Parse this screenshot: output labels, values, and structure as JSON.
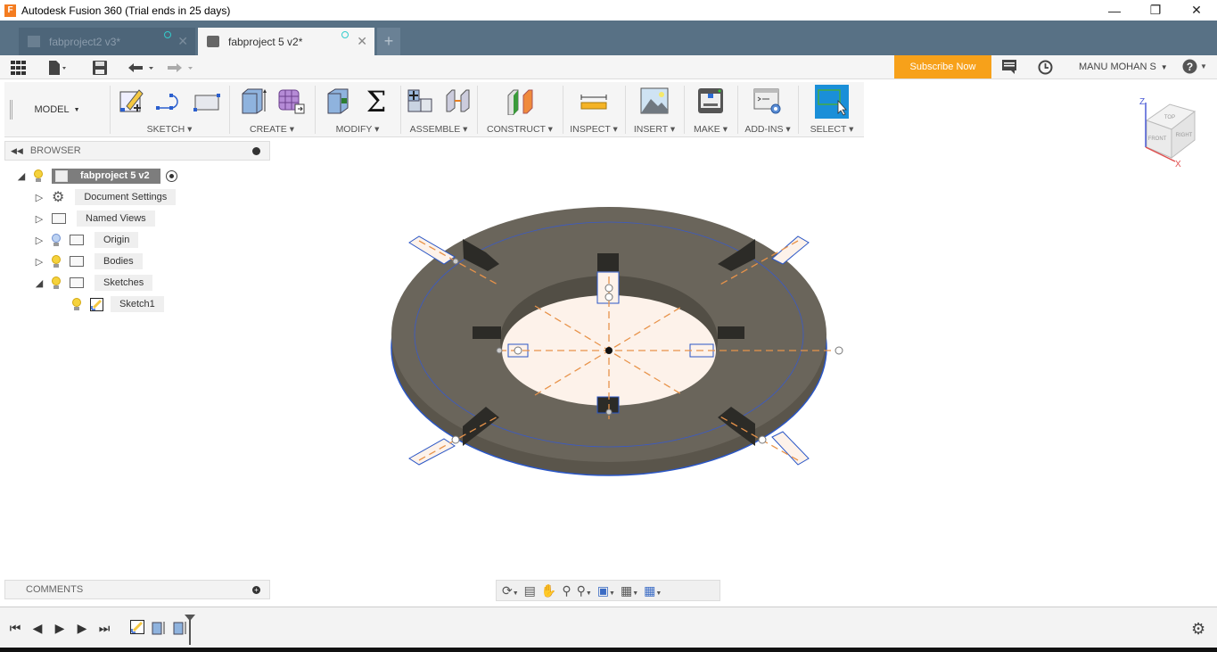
{
  "window": {
    "title": "Autodesk Fusion 360 (Trial ends in 25 days)",
    "controls": [
      "minimize",
      "restore",
      "close"
    ]
  },
  "tabs": [
    {
      "label": "fabproject2 v3*",
      "active": false
    },
    {
      "label": "fabproject 5 v2*",
      "active": true
    }
  ],
  "quick_access": {
    "subscribe_label": "Subscribe Now",
    "user_label": "MANU MOHAN S",
    "colors": {
      "subscribe": "#f7a11a",
      "tabbar": "#587185"
    }
  },
  "ribbon": {
    "workspace": "MODEL",
    "groups": [
      {
        "label": "SKETCH",
        "icons": [
          "create-sketch-icon",
          "line-icon",
          "rectangle-icon"
        ]
      },
      {
        "label": "CREATE",
        "icons": [
          "extrude-icon",
          "form-icon"
        ]
      },
      {
        "label": "MODIFY",
        "icons": [
          "press-pull-icon",
          "sum-icon"
        ]
      },
      {
        "label": "ASSEMBLE",
        "icons": [
          "new-component-icon",
          "joint-icon"
        ]
      },
      {
        "label": "CONSTRUCT",
        "icons": [
          "plane-icon"
        ]
      },
      {
        "label": "INSPECT",
        "icons": [
          "measure-icon"
        ]
      },
      {
        "label": "INSERT",
        "icons": [
          "insert-image-icon"
        ]
      },
      {
        "label": "MAKE",
        "icons": [
          "3d-print-icon"
        ]
      },
      {
        "label": "ADD-INS",
        "icons": [
          "scripts-icon"
        ]
      },
      {
        "label": "SELECT",
        "icons": [
          "select-icon"
        ]
      }
    ]
  },
  "browser": {
    "title": "BROWSER",
    "root": "fabproject 5 v2",
    "items": [
      {
        "label": "Document Settings",
        "icon": "gear-icon",
        "expanded": false
      },
      {
        "label": "Named Views",
        "icon": "folder-icon",
        "expanded": false
      },
      {
        "label": "Origin",
        "icon": "folder-icon",
        "expanded": false,
        "visible": false
      },
      {
        "label": "Bodies",
        "icon": "folder-icon",
        "expanded": false,
        "visible": true
      },
      {
        "label": "Sketches",
        "icon": "folder-icon",
        "expanded": true,
        "visible": true
      },
      {
        "label": "Sketch1",
        "icon": "sketch-icon",
        "child": true,
        "visible": true
      }
    ]
  },
  "comments": {
    "title": "COMMENTS"
  },
  "viewcube": {
    "top": "TOP",
    "front": "FRONT",
    "right": "RIGHT",
    "axis_z": "Z",
    "axis_x": "X"
  },
  "navbar": {
    "tools": [
      "orbit-icon",
      "look-at-icon",
      "pan-icon",
      "zoom-window-icon",
      "zoom-icon",
      "display-settings-icon",
      "grid-icon",
      "viewports-icon"
    ]
  },
  "timeline": {
    "controls": [
      "go-to-start",
      "step-back",
      "play",
      "step-forward",
      "go-to-end"
    ],
    "features": [
      "sketch-feature",
      "extrude-feature",
      "extrude-feature"
    ]
  }
}
